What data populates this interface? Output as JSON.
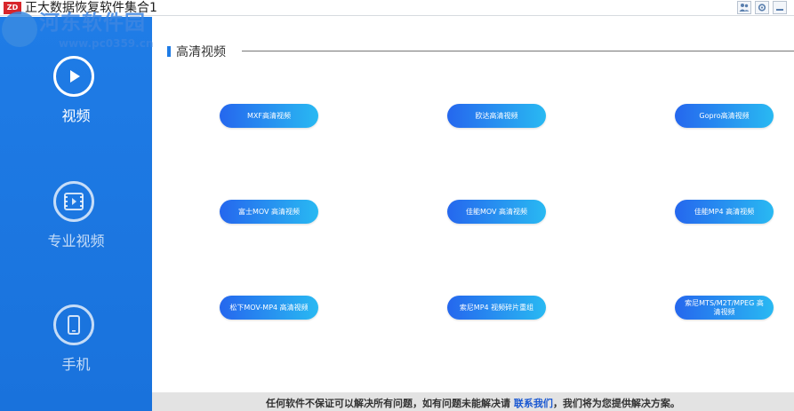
{
  "window": {
    "app_icon_text": "ZD",
    "title": "正大数据恢复软件集合1"
  },
  "watermark": {
    "brand": "河东软件园",
    "url": "www.pc0359.cn"
  },
  "sidebar": {
    "items": [
      {
        "label": "视频",
        "icon": "play-icon",
        "active": true
      },
      {
        "label": "专业视频",
        "icon": "film-icon",
        "active": false
      },
      {
        "label": "手机",
        "icon": "phone-icon",
        "active": false
      }
    ]
  },
  "section": {
    "title": "高清视频"
  },
  "tools": [
    {
      "label": "MXF高清视频"
    },
    {
      "label": "欧达高清视频"
    },
    {
      "label": "Gopro高清视频"
    },
    {
      "label": "富士MOV 高清视频"
    },
    {
      "label": "佳能MOV 高清视频"
    },
    {
      "label": "佳能MP4 高清视频"
    },
    {
      "label": "松下MOV-MP4 高清视频"
    },
    {
      "label": "索尼MP4 视频碎片重组"
    },
    {
      "label": "索尼MTS/M2T/MPEG 高清视频"
    }
  ],
  "footer": {
    "text_before": "任何软件不保证可以解决所有问题，如有问题未能解决请 ",
    "link": "联系我们",
    "text_after": "，我们将为您提供解决方案。"
  },
  "colors": {
    "sidebar": "#1f7ce6",
    "button_start": "#2567ee",
    "button_end": "#29b9f2",
    "footer_bg": "#e3e3e3",
    "link": "#1a58d2"
  }
}
